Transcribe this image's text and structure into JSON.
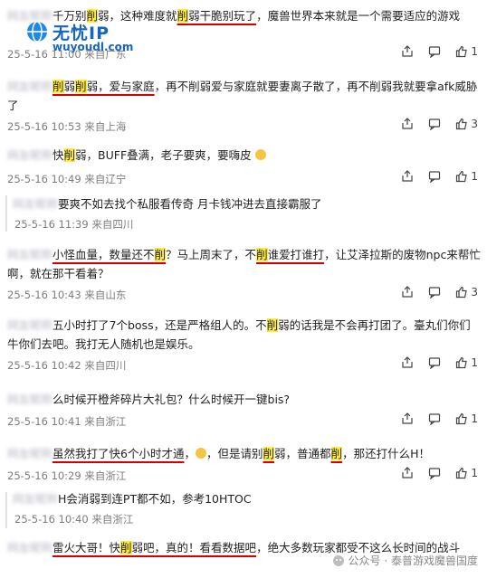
{
  "watermark": {
    "logo_top": "无忧IP",
    "logo_bottom": "wuyoudl.com",
    "footer": "公众号 · 泰普游戏魔兽国度"
  },
  "comments": [
    {
      "user": "网友昵称",
      "pre": "千万别",
      "hl1": "削",
      "mid": "弱，这种难度就",
      "hl2": "削",
      "u1": "弱干脆别玩了",
      "post": "，魔兽世界本来就是一个需要适应的游戏",
      "date": "25-5-16 11:00",
      "loc": "来自广东",
      "likes": "1"
    },
    {
      "user": "网友昵称",
      "hl1": "削",
      "u1": "弱",
      "hl2": "削",
      "u2": "弱，爱与家庭",
      "post": "，再不削弱爱与家庭就要妻离子散了，再不削弱我就要拿afk威胁了",
      "date": "25-5-16 10:53",
      "loc": "来自上海",
      "likes": "3"
    },
    {
      "user": "网友昵称",
      "pre": "快",
      "hl1": "削",
      "post": "弱，BUFF叠满，老子要爽，要嗨皮",
      "date": "25-5-16 10:49",
      "loc": "来自辽宁",
      "likes": "1"
    },
    {
      "user": "网友昵称",
      "post": "要爽不如去找个私服看传奇 月卡钱冲进去直接霸服了",
      "date": "25-5-16 11:39",
      "loc": "来自四川",
      "reply": true
    },
    {
      "user": "网友昵称",
      "pre": "小怪血量，数量还不",
      "hl1": "削",
      "mid": "？马上周末了，不",
      "hl2": "削",
      "u1": "谁爱打谁打",
      "post": "，让艾泽拉斯的废物npc来帮忙啊，就在那干看着？",
      "date": "25-5-16 10:43",
      "loc": "来自山东",
      "likes": "3"
    },
    {
      "user": "网友昵称",
      "pre": "五小时打了7个boss，还是严格组人的。不",
      "hl1": "削",
      "post": "弱的话我是不会再打团了。臺丸们你们牛你们去吧。我打无人随机也是娱乐。",
      "date": "25-5-16 10:42",
      "loc": "来自四川",
      "likes": "1"
    },
    {
      "user": "网友昵称",
      "post": "么时候开橙斧碎片大礼包？什么时候开一键bis?",
      "date": "25-5-16 10:41",
      "loc": "来自浙江",
      "likes": "1"
    },
    {
      "user": "网友昵称",
      "u1": "虽然我打了快6个小时才通",
      "mid": "，但是请别",
      "hl1": "削",
      "mid2": "弱，普通都",
      "hl2": "削",
      "post": "，那还打什么H！",
      "date": "25-5-16 10:29",
      "loc": "来自浙江",
      "likes": "1"
    },
    {
      "user": "网友昵称",
      "post": "H会消弱到连PT都不如，参考10HTOC",
      "date": "25-5-16 10:40",
      "loc": "来自浙江",
      "reply": true
    },
    {
      "user": "网友昵称",
      "u1": "雷火大哥！快",
      "hl1": "削",
      "u2": "弱吧，真的！看看数据吧",
      "post": "，绝大多数玩家都受不这么长时间的战斗"
    }
  ]
}
